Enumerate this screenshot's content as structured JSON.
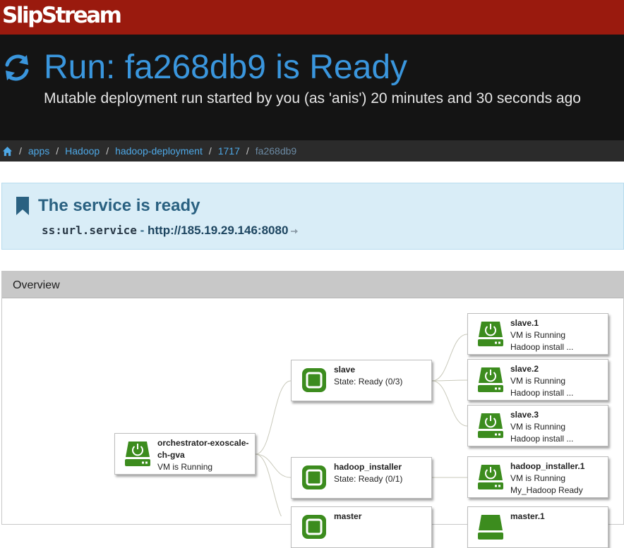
{
  "app": {
    "logo_text": "SlipStream"
  },
  "header": {
    "title": "Run: fa268db9 is Ready",
    "subtitle": "Mutable deployment run started by you (as 'anis') 20 minutes and 30 seconds ago",
    "title_color": "#3a96dd"
  },
  "breadcrumb": {
    "home_icon": "home-icon",
    "items": [
      "apps",
      "Hadoop",
      "hadoop-deployment",
      "1717",
      "fa268db9"
    ],
    "separator": "/"
  },
  "alert": {
    "title": "The service is ready",
    "key": "ss:url.service",
    "dash": "-",
    "url": "http://185.19.29.146:8080"
  },
  "overview": {
    "title": "Overview",
    "nodes": [
      {
        "id": "orchestrator",
        "icon": "vm-power-icon",
        "name": "orchestrator-exoscale-ch-gva",
        "lines": [
          "VM is Running"
        ]
      },
      {
        "id": "slave",
        "icon": "deployment-node-icon",
        "name": "slave",
        "lines": [
          "State: Ready (0/3)"
        ]
      },
      {
        "id": "hadoop_installer",
        "icon": "deployment-node-icon",
        "name": "hadoop_installer",
        "lines": [
          "State: Ready (0/1)"
        ]
      },
      {
        "id": "master",
        "icon": "deployment-node-icon",
        "name": "master",
        "lines": []
      },
      {
        "id": "slave1",
        "icon": "vm-power-icon",
        "name": "slave.1",
        "lines": [
          "VM is Running",
          "Hadoop install ..."
        ]
      },
      {
        "id": "slave2",
        "icon": "vm-power-icon",
        "name": "slave.2",
        "lines": [
          "VM is Running",
          "Hadoop install ..."
        ]
      },
      {
        "id": "slave3",
        "icon": "vm-power-icon",
        "name": "slave.3",
        "lines": [
          "VM is Running",
          "Hadoop install ..."
        ]
      },
      {
        "id": "hadoop_installer1",
        "icon": "vm-power-icon",
        "name": "hadoop_installer.1",
        "lines": [
          "VM is Running",
          "My_Hadoop Ready"
        ]
      },
      {
        "id": "master1",
        "icon": "vm-power-icon",
        "name": "master.1",
        "lines": []
      }
    ]
  },
  "colors": {
    "topbar": "#9a1a0e",
    "header_bg": "#141414",
    "breadcrumb_bg": "#2b2b2b",
    "link": "#4ea8e6",
    "alert_bg": "#d9edf7",
    "node_green": "#3c8c1e"
  }
}
